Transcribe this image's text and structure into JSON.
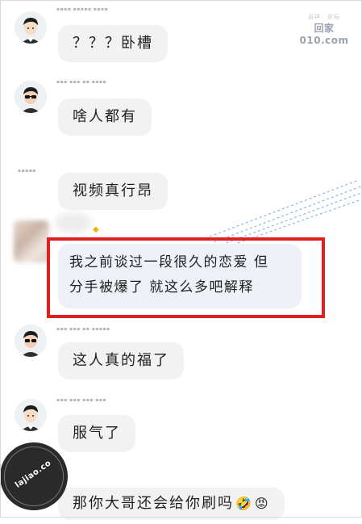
{
  "watermark": {
    "line1": "吉祥　论坛",
    "line2": "回家010.com"
  },
  "badge": {
    "text": "lajiao.co"
  },
  "messages": [
    {
      "text": "？？？卧槽"
    },
    {
      "text": "啥人都有"
    },
    {
      "text": "视频真行昂"
    },
    {
      "line1": "我之前谈过一段很久的恋爱 但",
      "line2": "分手被爆了 就这么多吧解释"
    },
    {
      "text": "这人真的福了"
    },
    {
      "text": "服气了"
    },
    {
      "text": "那你大哥还会给你刷吗",
      "emoji1": "🤣",
      "emoji2": "😡"
    }
  ],
  "colors": {
    "highlight_border": "#e02020",
    "bubble_bg": "#f2f2f2"
  }
}
